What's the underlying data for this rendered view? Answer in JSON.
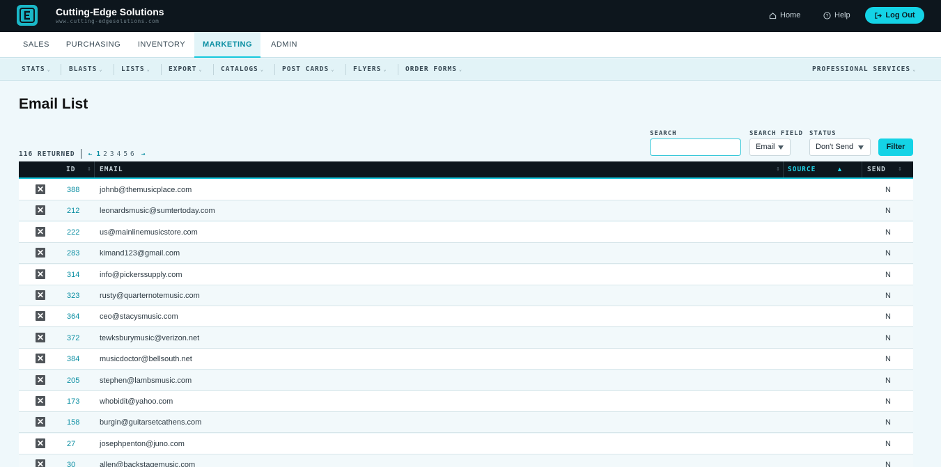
{
  "brand": {
    "name": "Cutting-Edge Solutions",
    "url": "www.cutting-edgesolutions.com"
  },
  "top_links": {
    "home": "Home",
    "help": "Help",
    "logout": "Log Out"
  },
  "main_tabs": [
    "SALES",
    "PURCHASING",
    "INVENTORY",
    "MARKETING",
    "ADMIN"
  ],
  "active_main_tab": "MARKETING",
  "sub_nav": [
    "STATS",
    "BLASTS",
    "LISTS",
    "EXPORT",
    "CATALOGS",
    "POST CARDS",
    "FLYERS",
    "ORDER FORMS"
  ],
  "sub_nav_right": "PROFESSIONAL SERVICES",
  "page_title": "Email List",
  "pager": {
    "returned": "116 RETURNED",
    "prev": "←",
    "next": "→",
    "pages": [
      "1",
      "2",
      "3",
      "4",
      "5",
      "6"
    ],
    "current": "1"
  },
  "filters": {
    "search_label": "SEARCH",
    "search_value": "",
    "field_label": "SEARCH FIELD",
    "field_value": "Email",
    "status_label": "STATUS",
    "status_value": "Don't Send",
    "filter_button": "Filter"
  },
  "table": {
    "columns": {
      "id": "ID",
      "email": "EMAIL",
      "source": "SOURCE",
      "send": "SEND"
    },
    "sorted_by": "SOURCE",
    "rows": [
      {
        "id": "388",
        "email": "johnb@themusicplace.com",
        "send": "N"
      },
      {
        "id": "212",
        "email": "leonardsmusic@sumtertoday.com",
        "send": "N"
      },
      {
        "id": "222",
        "email": "us@mainlinemusicstore.com",
        "send": "N"
      },
      {
        "id": "283",
        "email": "kimand123@gmail.com",
        "send": "N"
      },
      {
        "id": "314",
        "email": "info@pickerssupply.com",
        "send": "N"
      },
      {
        "id": "323",
        "email": "rusty@quarternotemusic.com",
        "send": "N"
      },
      {
        "id": "364",
        "email": "ceo@stacysmusic.com",
        "send": "N"
      },
      {
        "id": "372",
        "email": "tewksburymusic@verizon.net",
        "send": "N"
      },
      {
        "id": "384",
        "email": "musicdoctor@bellsouth.net",
        "send": "N"
      },
      {
        "id": "205",
        "email": "stephen@lambsmusic.com",
        "send": "N"
      },
      {
        "id": "173",
        "email": "whobidit@yahoo.com",
        "send": "N"
      },
      {
        "id": "158",
        "email": "burgin@guitarsetcathens.com",
        "send": "N"
      },
      {
        "id": "27",
        "email": "josephpenton@juno.com",
        "send": "N"
      },
      {
        "id": "30",
        "email": "allen@backstagemusic.com",
        "send": "N"
      }
    ]
  },
  "colors": {
    "accent": "#14d3e6",
    "dark": "#0d161d",
    "link": "#0a8ea2"
  }
}
